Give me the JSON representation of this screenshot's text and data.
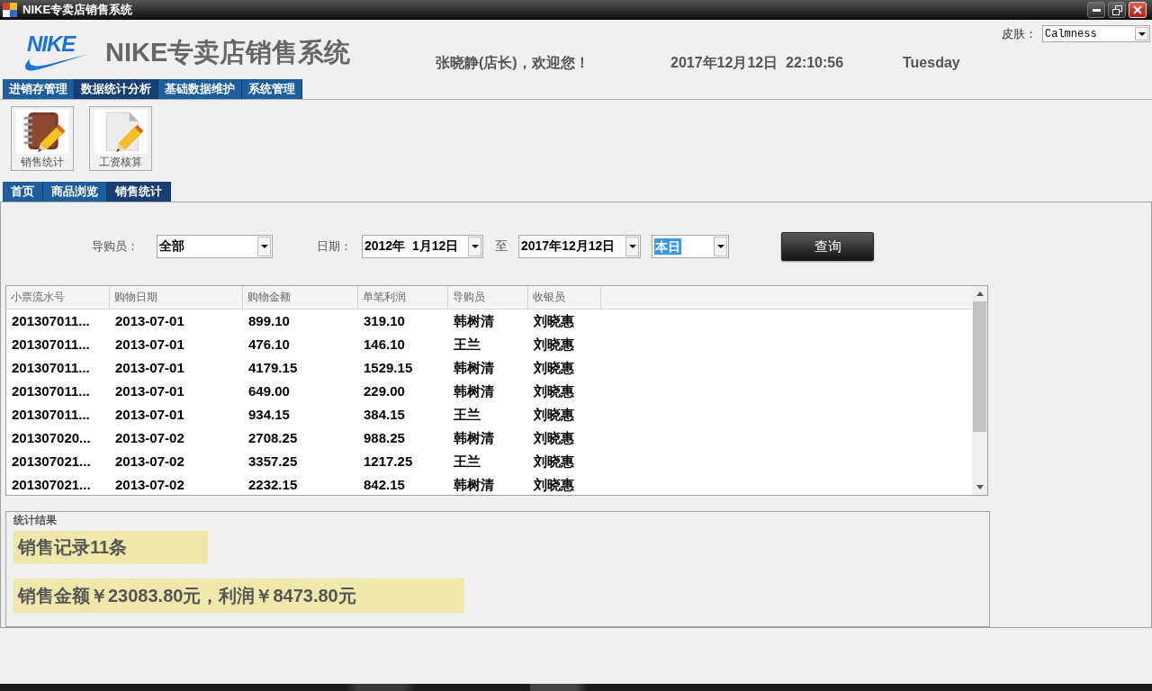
{
  "window": {
    "title": "NIKE专卖店销售系统"
  },
  "header": {
    "logo_text": "NIKE",
    "app_title": "NIKE专卖店销售系统",
    "welcome": "张晓静(店长)，欢迎您！",
    "datetime": "2017年12月12日  22:10:56",
    "weekday": "Tuesday",
    "skin": {
      "label": "皮肤：",
      "value": "Calmness"
    }
  },
  "menu_tabs": [
    {
      "label": "进销存管理",
      "selected": false
    },
    {
      "label": "数据统计分析",
      "selected": true
    },
    {
      "label": "基础数据维护",
      "selected": false
    },
    {
      "label": "系统管理",
      "selected": false
    }
  ],
  "toolbar": [
    {
      "label": "销售统计",
      "kind": "notebook"
    },
    {
      "label": "工资核算",
      "kind": "document"
    }
  ],
  "page_tabs": [
    {
      "label": "首页",
      "selected": false
    },
    {
      "label": "商品浏览",
      "selected": false
    },
    {
      "label": "销售统计",
      "selected": true
    }
  ],
  "filters": {
    "salesperson_label": "导购员：",
    "salesperson": "全部",
    "date_label": "日期：",
    "date_from": "2012年  1月12日",
    "to_label": "至",
    "date_to": "2017年12月12日",
    "period": {
      "value": "本日",
      "highlighted": true
    },
    "query_button": "查询"
  },
  "table": {
    "columns": [
      "小票流水号",
      "购物日期",
      "购物金额",
      "单笔利润",
      "导购员",
      "收银员"
    ],
    "rows": [
      [
        "201307011...",
        "2013-07-01",
        "899.10",
        "319.10",
        "韩树清",
        "刘晓惠"
      ],
      [
        "201307011...",
        "2013-07-01",
        "476.10",
        "146.10",
        "王兰",
        "刘晓惠"
      ],
      [
        "201307011...",
        "2013-07-01",
        "4179.15",
        "1529.15",
        "韩树清",
        "刘晓惠"
      ],
      [
        "201307011...",
        "2013-07-01",
        "649.00",
        "229.00",
        "韩树清",
        "刘晓惠"
      ],
      [
        "201307011...",
        "2013-07-01",
        "934.15",
        "384.15",
        "王兰",
        "刘晓惠"
      ],
      [
        "201307020...",
        "2013-07-02",
        "2708.25",
        "988.25",
        "韩树清",
        "刘晓惠"
      ],
      [
        "201307021...",
        "2013-07-02",
        "3357.25",
        "1217.25",
        "王兰",
        "刘晓惠"
      ],
      [
        "201307021...",
        "2013-07-02",
        "2232.15",
        "842.15",
        "韩树清",
        "刘晓惠"
      ]
    ]
  },
  "stats": {
    "title": "统计结果",
    "lines": [
      "销售记录11条",
      "销售金额￥23083.80元，利润￥8473.80元"
    ]
  }
}
